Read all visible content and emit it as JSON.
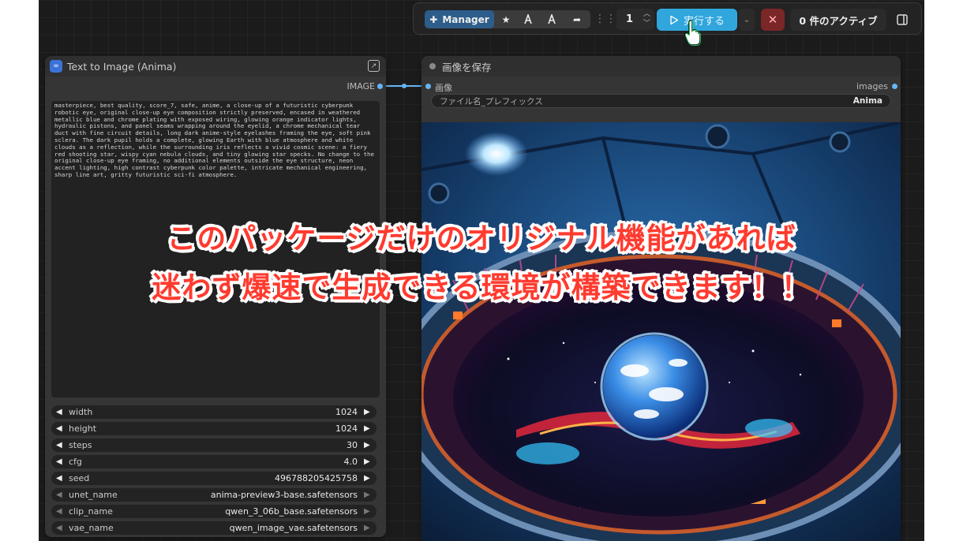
{
  "toolbar": {
    "manager_label": "Manager",
    "icons": [
      "star-icon",
      "bookmark-a-icon",
      "bookmark-a-alt-icon",
      "share-arrow-icon"
    ],
    "batch_count": "1",
    "run_label": "実行する",
    "queue_label": "0 件のアクティブ",
    "colors": {
      "run": "#30a6dc",
      "cancel": "#7b2727",
      "manager": "#2d5d8a"
    }
  },
  "node1": {
    "title": "Text to Image (Anima)",
    "output_label": "IMAGE",
    "prompt": "masterpiece, best quality, score_7, safe, anime, a close-up of a futuristic cyberpunk robotic eye, original close-up eye composition strictly preserved, encased in weathered metallic blue and chrome plating with exposed wiring, glowing orange indicator lights, hydraulic pistons, and panel seams wrapping around the eyelid, a chrome mechanical tear duct with fine circuit details, long dark anime-style eyelashes framing the eye, soft pink sclera. The dark pupil holds a complete, glowing Earth with blue atmosphere and white clouds as a reflection, while the surrounding iris reflects a vivid cosmic scene: a fiery red shooting star, wispy cyan nebula clouds, and tiny glowing star specks. No change to the original close-up eye framing, no additional elements outside the eye structure, neon accent lighting, high contrast cyberpunk color palette, intricate mechanical engineering, sharp line art, gritty futuristic sci-fi atmosphere.",
    "widgets": [
      {
        "name": "width",
        "value": "1024",
        "dim": false
      },
      {
        "name": "height",
        "value": "1024",
        "dim": false
      },
      {
        "name": "steps",
        "value": "30",
        "dim": false
      },
      {
        "name": "cfg",
        "value": "4.0",
        "dim": false
      },
      {
        "name": "seed",
        "value": "496788205425758",
        "dim": false
      },
      {
        "name": "unet_name",
        "value": "anima-preview3-base.safetensors",
        "dim": true
      },
      {
        "name": "clip_name",
        "value": "qwen_3_06b_base.safetensors",
        "dim": true
      },
      {
        "name": "vae_name",
        "value": "qwen_image_vae.safetensors",
        "dim": true
      }
    ]
  },
  "node2": {
    "title": "画像を保存",
    "input_label": "画像",
    "output_label": "images",
    "prefix_label": "ファイル名_プレフィックス",
    "prefix_value": "Anima"
  },
  "caption": {
    "line1": "このパッケージだけのオリジナル機能があれば",
    "line2": "迷わず爆速で生成できる環境が構築できます！！",
    "color": "#ff3b2f"
  }
}
